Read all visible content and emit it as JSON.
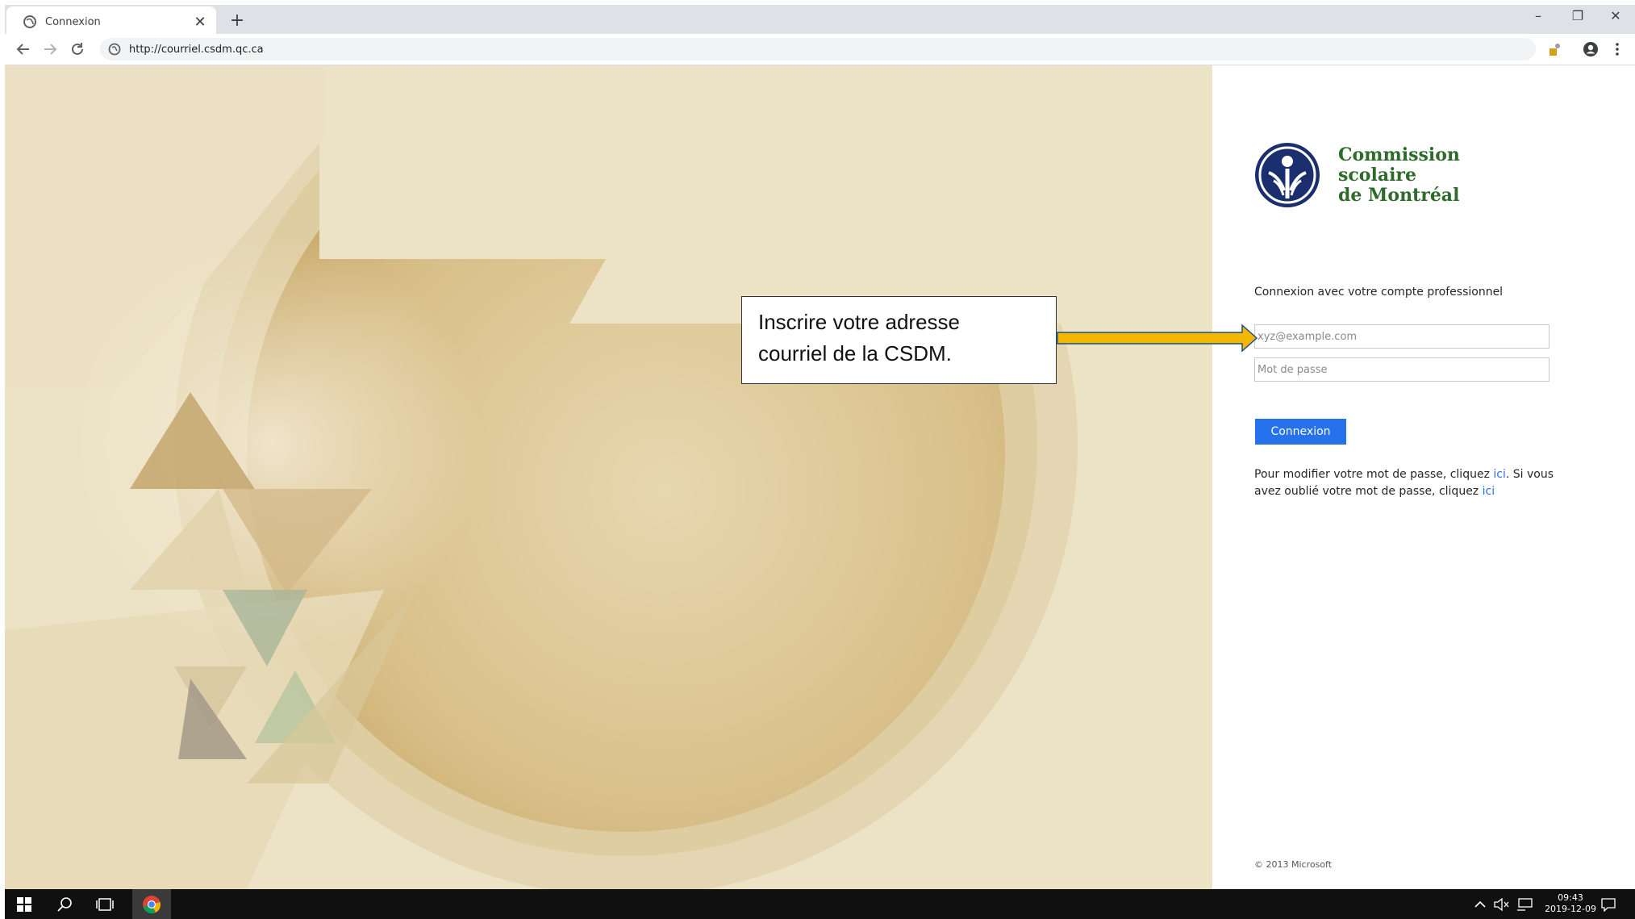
{
  "browser": {
    "tab_title": "Connexion",
    "tab_close": "✕",
    "new_tab": "+",
    "url": "http://courriel.csdm.qc.ca",
    "window": {
      "minimize": "–",
      "restore": "❐",
      "close": "✕"
    }
  },
  "login": {
    "org_name_line1": "Commission",
    "org_name_line2": "scolaire",
    "org_name_line3": "de Montréal",
    "heading": "Connexion avec votre compte professionnel",
    "email_placeholder": "xyz@example.com",
    "password_placeholder": "Mot de passe",
    "submit_label": "Connexion",
    "help_part1": "Pour modifier votre mot de passe, cliquez ",
    "help_link1": "ici",
    "help_part2": ". Si vous avez oublié votre mot de passe, cliquez ",
    "help_link2": "ici",
    "copyright": "© 2013 Microsoft"
  },
  "annotation": {
    "text_line1": "Inscrire votre adresse",
    "text_line2": "courriel de la CSDM.",
    "arrow_color": "#f2b800"
  },
  "taskbar": {
    "clock_time": "09:43",
    "clock_date": "2019-12-09"
  },
  "colors": {
    "accent": "#2672ec",
    "brand_green": "#2e6b2a",
    "brand_blue": "#1b2f6e",
    "background_beige": "#ece2c6"
  }
}
